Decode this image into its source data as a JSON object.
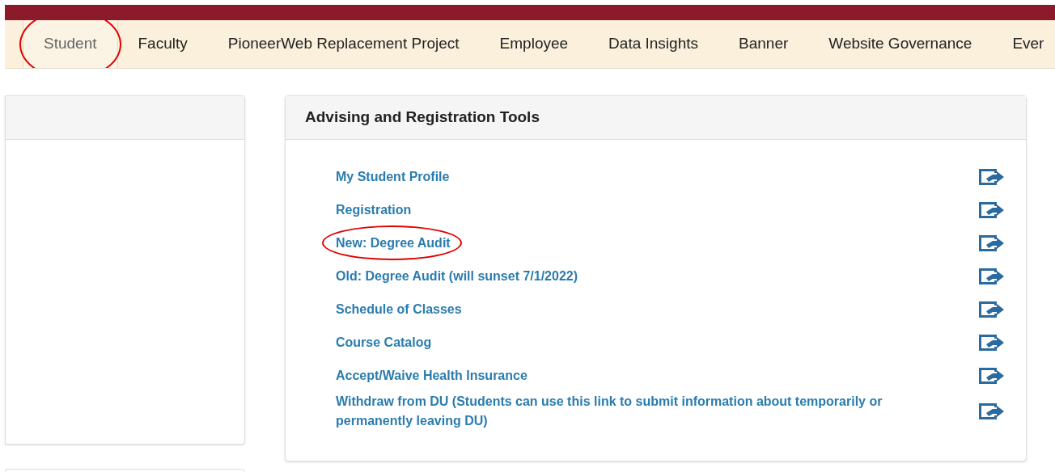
{
  "tabs": [
    {
      "label": "Student",
      "selected": true,
      "circled": true
    },
    {
      "label": "Faculty",
      "selected": false,
      "circled": false
    },
    {
      "label": "PioneerWeb Replacement Project",
      "selected": false,
      "circled": false
    },
    {
      "label": "Employee",
      "selected": false,
      "circled": false
    },
    {
      "label": "Data Insights",
      "selected": false,
      "circled": false
    },
    {
      "label": "Banner",
      "selected": false,
      "circled": false
    },
    {
      "label": "Website Governance",
      "selected": false,
      "circled": false
    },
    {
      "label": "Ever",
      "selected": false,
      "circled": false
    }
  ],
  "panel": {
    "title": "Advising and Registration Tools",
    "links": [
      {
        "label": "My Student Profile",
        "circled": false
      },
      {
        "label": "Registration",
        "circled": false
      },
      {
        "label": "New: Degree Audit",
        "circled": true
      },
      {
        "label": "Old: Degree Audit (will sunset 7/1/2022)",
        "circled": false
      },
      {
        "label": "Schedule of Classes",
        "circled": false
      },
      {
        "label": "Course Catalog",
        "circled": false
      },
      {
        "label": "Accept/Waive Health Insurance",
        "circled": false
      },
      {
        "label": "Withdraw from DU (Students can use this link to submit information about temporarily or permanently leaving DU)",
        "circled": false
      }
    ]
  }
}
